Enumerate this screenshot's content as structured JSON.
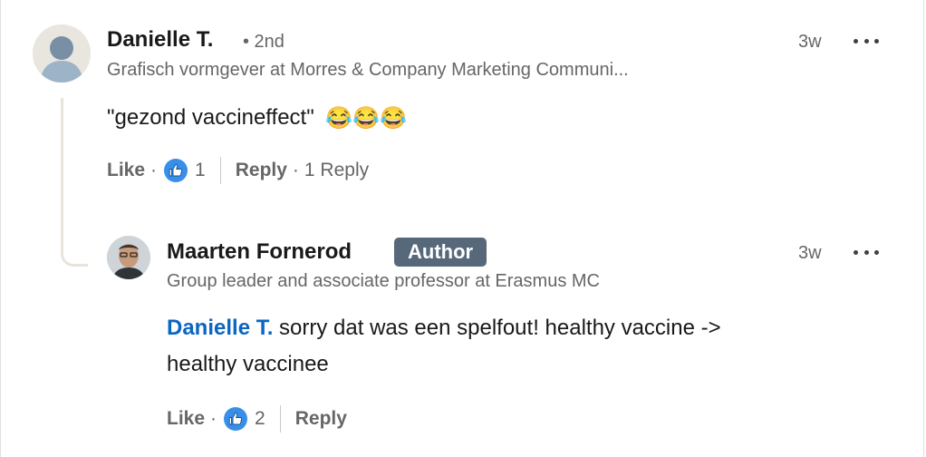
{
  "comments": [
    {
      "author": "Danielle T.",
      "degree": "• 2nd",
      "headline": "Grafisch vormgever at Morres & Company Marketing Communi...",
      "time": "3w",
      "text": "\"gezond vaccineffect\"",
      "emoji": [
        "😂",
        "😂",
        "😂"
      ],
      "actions": {
        "like": "Like",
        "like_count": "1",
        "reply": "Reply",
        "reply_count": "1 Reply"
      }
    },
    {
      "author": "Maarten Fornerod",
      "badge": "Author",
      "headline": "Group leader and associate professor at Erasmus MC",
      "time": "3w",
      "mention": "Danielle T.",
      "text_line1": " sorry dat was een spelfout! healthy vaccine ->",
      "text_line2": "healthy vaccinee",
      "actions": {
        "like": "Like",
        "like_count": "2",
        "reply": "Reply"
      }
    }
  ],
  "icons": {
    "more": "more-icon",
    "like": "thumbs-up-icon",
    "colors": {
      "like_blue": "#378fe9",
      "badge": "#56687a",
      "mention": "#0a66c2"
    }
  }
}
